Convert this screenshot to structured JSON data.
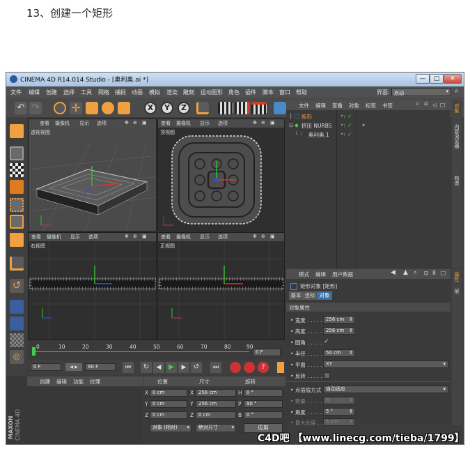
{
  "caption": "13、创建一个矩形",
  "window": {
    "title": "CINEMA 4D R14.014 Studio - [奥利奥.ai *]",
    "controls": [
      "—",
      "□",
      "✕"
    ]
  },
  "menu": {
    "items": [
      "文件",
      "编辑",
      "创建",
      "选择",
      "工具",
      "网格",
      "捕捉",
      "动画",
      "模拟",
      "渲染",
      "雕刻",
      "运动图形",
      "角色",
      "插件",
      "脚本",
      "窗口",
      "帮助"
    ],
    "layout_label": "界面:",
    "layout_value": "启动"
  },
  "toolbar": {
    "axis_x": "X",
    "axis_y": "Y",
    "axis_z": "Z"
  },
  "viewports": {
    "menu": [
      "查看",
      "摄像机",
      "显示",
      "选项"
    ],
    "perspective_label": "透视视图",
    "top_label": "顶视图",
    "right_label": "右视图",
    "front_label": "正视图"
  },
  "objects": {
    "menu": [
      "文件",
      "编辑",
      "查看",
      "对象",
      "标签",
      "书签"
    ],
    "items": [
      {
        "name": "矩形",
        "color": "#f0a040"
      },
      {
        "name": "挤压 NURBS",
        "color": "#dddddd"
      },
      {
        "name": "奥利奥.1",
        "color": "#dddddd"
      }
    ],
    "side_tabs": [
      "对象",
      "内容浏览器",
      "构造"
    ]
  },
  "attributes": {
    "menu": [
      "模式",
      "编辑",
      "用户数据"
    ],
    "object_title": "矩形对象 [矩形]",
    "tabs": [
      "基本",
      "坐标",
      "对象"
    ],
    "active_tab": "对象",
    "section": "对象属性",
    "rows": [
      {
        "label": "宽度",
        "value": "256 cm"
      },
      {
        "label": "高度",
        "value": "256 cm"
      },
      {
        "label": "圆角",
        "value": "✓"
      },
      {
        "label": "半径",
        "value": "50 cm"
      },
      {
        "label": "平面",
        "value": "XY"
      },
      {
        "label": "反转",
        "value": ""
      }
    ],
    "interp_label": "点插值方式",
    "interp_value": "自动适应",
    "count_label": "数量",
    "count_value": "8",
    "angle_label": "角度",
    "angle_value": "5 °",
    "maxlen_label": "最大长度",
    "maxlen_value": "5 cm",
    "side_tabs": [
      "属性",
      "层"
    ]
  },
  "timeline": {
    "ticks": [
      "0",
      "10",
      "20",
      "30",
      "40",
      "50",
      "60",
      "70",
      "80",
      "90"
    ],
    "frame_field": "0 F",
    "start_field": "0 F",
    "end_field": "90 F"
  },
  "materials": {
    "menu": [
      "创建",
      "编辑",
      "功能",
      "纹理"
    ],
    "brand_top": "MAXON",
    "brand_bottom": "CINEMA 4D"
  },
  "coords": {
    "headers": [
      "位置",
      "尺寸",
      "旋转"
    ],
    "rows": [
      {
        "axis": "X",
        "pos": "0 cm",
        "size_axis": "X",
        "size": "256 cm",
        "rot_axis": "H",
        "rot": "0 °"
      },
      {
        "axis": "Y",
        "pos": "0 cm",
        "size_axis": "Y",
        "size": "256 cm",
        "rot_axis": "P",
        "rot": "90 °"
      },
      {
        "axis": "Z",
        "pos": "0 cm",
        "size_axis": "Z",
        "size": "0 cm",
        "rot_axis": "B",
        "rot": "0 °"
      }
    ],
    "mode_select": "对象 (相对)",
    "size_select": "绝对尺寸",
    "apply_label": "应用"
  },
  "watermark": "C4D吧 【www.linecg.com/tieba/1799】",
  "colors": {
    "accent_orange": "#f0a040",
    "active_tab_blue": "#3a6ea5",
    "window_bg": "#3c3c3c"
  }
}
